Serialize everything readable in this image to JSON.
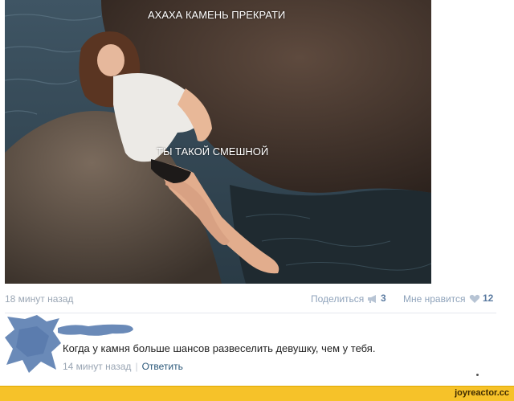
{
  "post": {
    "caption_top": "АХАХА КАМЕНЬ ПРЕКРАТИ",
    "caption_middle": "ТЫ ТАКОЙ СМЕШНОЙ",
    "timestamp": "18 минут назад",
    "share_label": "Поделиться",
    "share_count": "3",
    "like_label": "Мне нравится",
    "like_count": "12"
  },
  "comment": {
    "text": "Когда у камня больше шансов развеселить девушку, чем у тебя.",
    "timestamp": "14 минут назад",
    "separator": "|",
    "reply_label": "Ответить"
  },
  "footer": {
    "watermark": "joyreactor.cc"
  },
  "colors": {
    "link": "#2b587a",
    "counter": "#5b7ba1",
    "footer_bg": "#f6c229",
    "avatar_redaction": "#6a8ab8"
  },
  "icons": [
    "megaphone-icon",
    "heart-icon"
  ]
}
